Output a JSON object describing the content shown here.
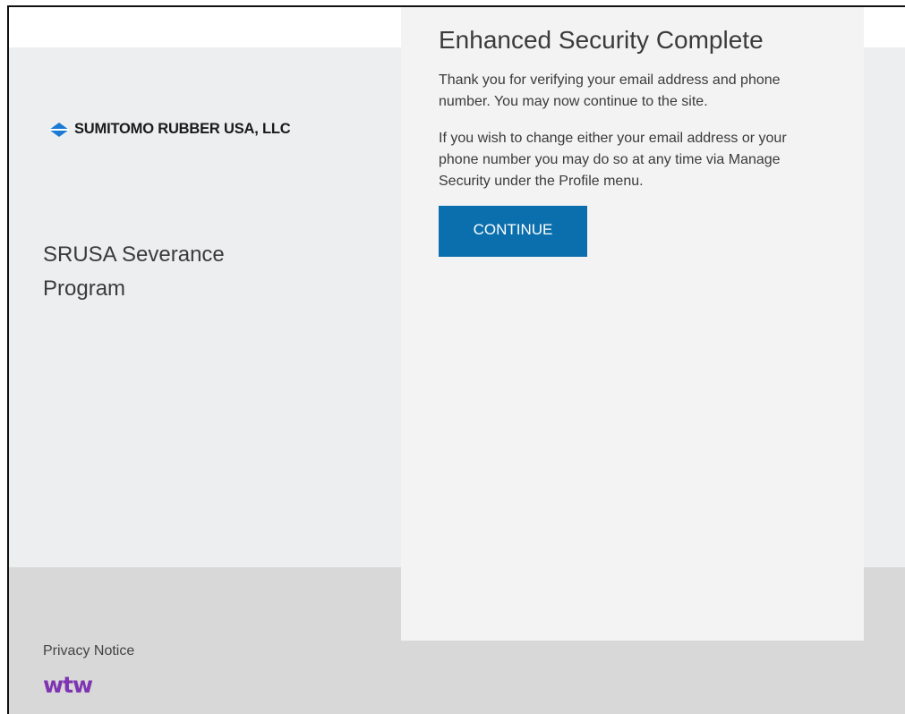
{
  "brand": {
    "name": "SUMITOMO RUBBER USA, LLC",
    "icon": "sumitomo-diamond-icon",
    "icon_color": "#1a7ad4"
  },
  "program": {
    "line1": "SRUSA Severance",
    "line2": "Program"
  },
  "card": {
    "title": "Enhanced Security Complete",
    "paragraph1": "Thank you for verifying your email address and phone number. You may now continue to the site.",
    "paragraph2": "If you wish to change either your email address or your phone number you may do so at any time via Manage Security under the Profile menu.",
    "continue_label": "CONTINUE"
  },
  "footer": {
    "privacy_label": "Privacy Notice",
    "logo_text": "wtw",
    "logo_color": "#7f35b2"
  },
  "colors": {
    "primary_button": "#0b6fad",
    "page_background": "#eceef0",
    "footer_background": "#d8d8d8",
    "card_background": "#f3f3f3"
  }
}
